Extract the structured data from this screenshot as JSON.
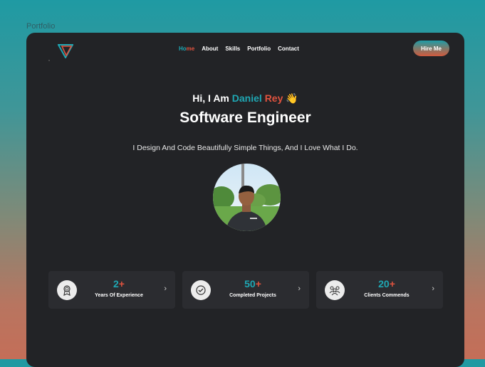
{
  "frame_label": "Portfolio",
  "nav": {
    "home_part1": "Ho",
    "home_part2": "me",
    "items": [
      "About",
      "Skills",
      "Portfolio",
      "Contact"
    ]
  },
  "hire_label": "Hire Me",
  "hero": {
    "greeting_prefix": "Hi, I Am ",
    "first_name": "Daniel",
    "last_name": "Rey",
    "wave": "👋",
    "title": "Software Engineer",
    "tagline": "I Design And Code Beautifully Simple Things, And I Love What I Do."
  },
  "stats": [
    {
      "value": "2",
      "suffix": "+",
      "label": "Years Of Experience",
      "icon": "award-icon"
    },
    {
      "value": "50",
      "suffix": "+",
      "label": "Completed Projects",
      "icon": "check-badge-icon"
    },
    {
      "value": "20",
      "suffix": "+",
      "label": "Clients Commends",
      "icon": "group-icon"
    }
  ],
  "colors": {
    "accent_teal": "#1fa7b3",
    "accent_orange": "#e0533f",
    "card_bg": "#222326",
    "stat_bg": "#2b2c30"
  }
}
